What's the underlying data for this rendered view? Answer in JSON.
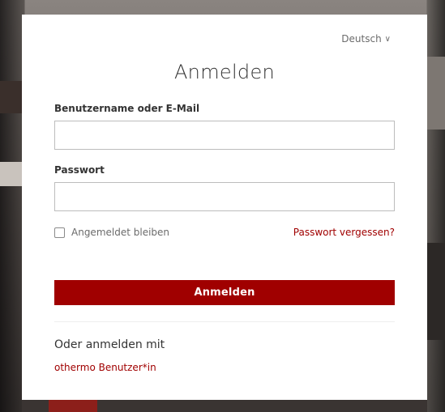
{
  "language": {
    "selected": "Deutsch",
    "chevron_icon": "chevron-down-icon"
  },
  "form": {
    "title": "Anmelden",
    "username_label": "Benutzername oder E-Mail",
    "username_value": "",
    "password_label": "Passwort",
    "password_value": "",
    "remember_label": "Angemeldet bleiben",
    "remember_checked": false,
    "forgot_link": "Passwort vergessen?",
    "submit_label": "Anmelden"
  },
  "alternative": {
    "heading": "Oder anmelden mit",
    "providers": [
      "othermo Benutzer*in"
    ]
  },
  "colors": {
    "accent": "#a00000",
    "text": "#333333",
    "muted": "#6b6b6b",
    "border": "#bdbdbd"
  }
}
